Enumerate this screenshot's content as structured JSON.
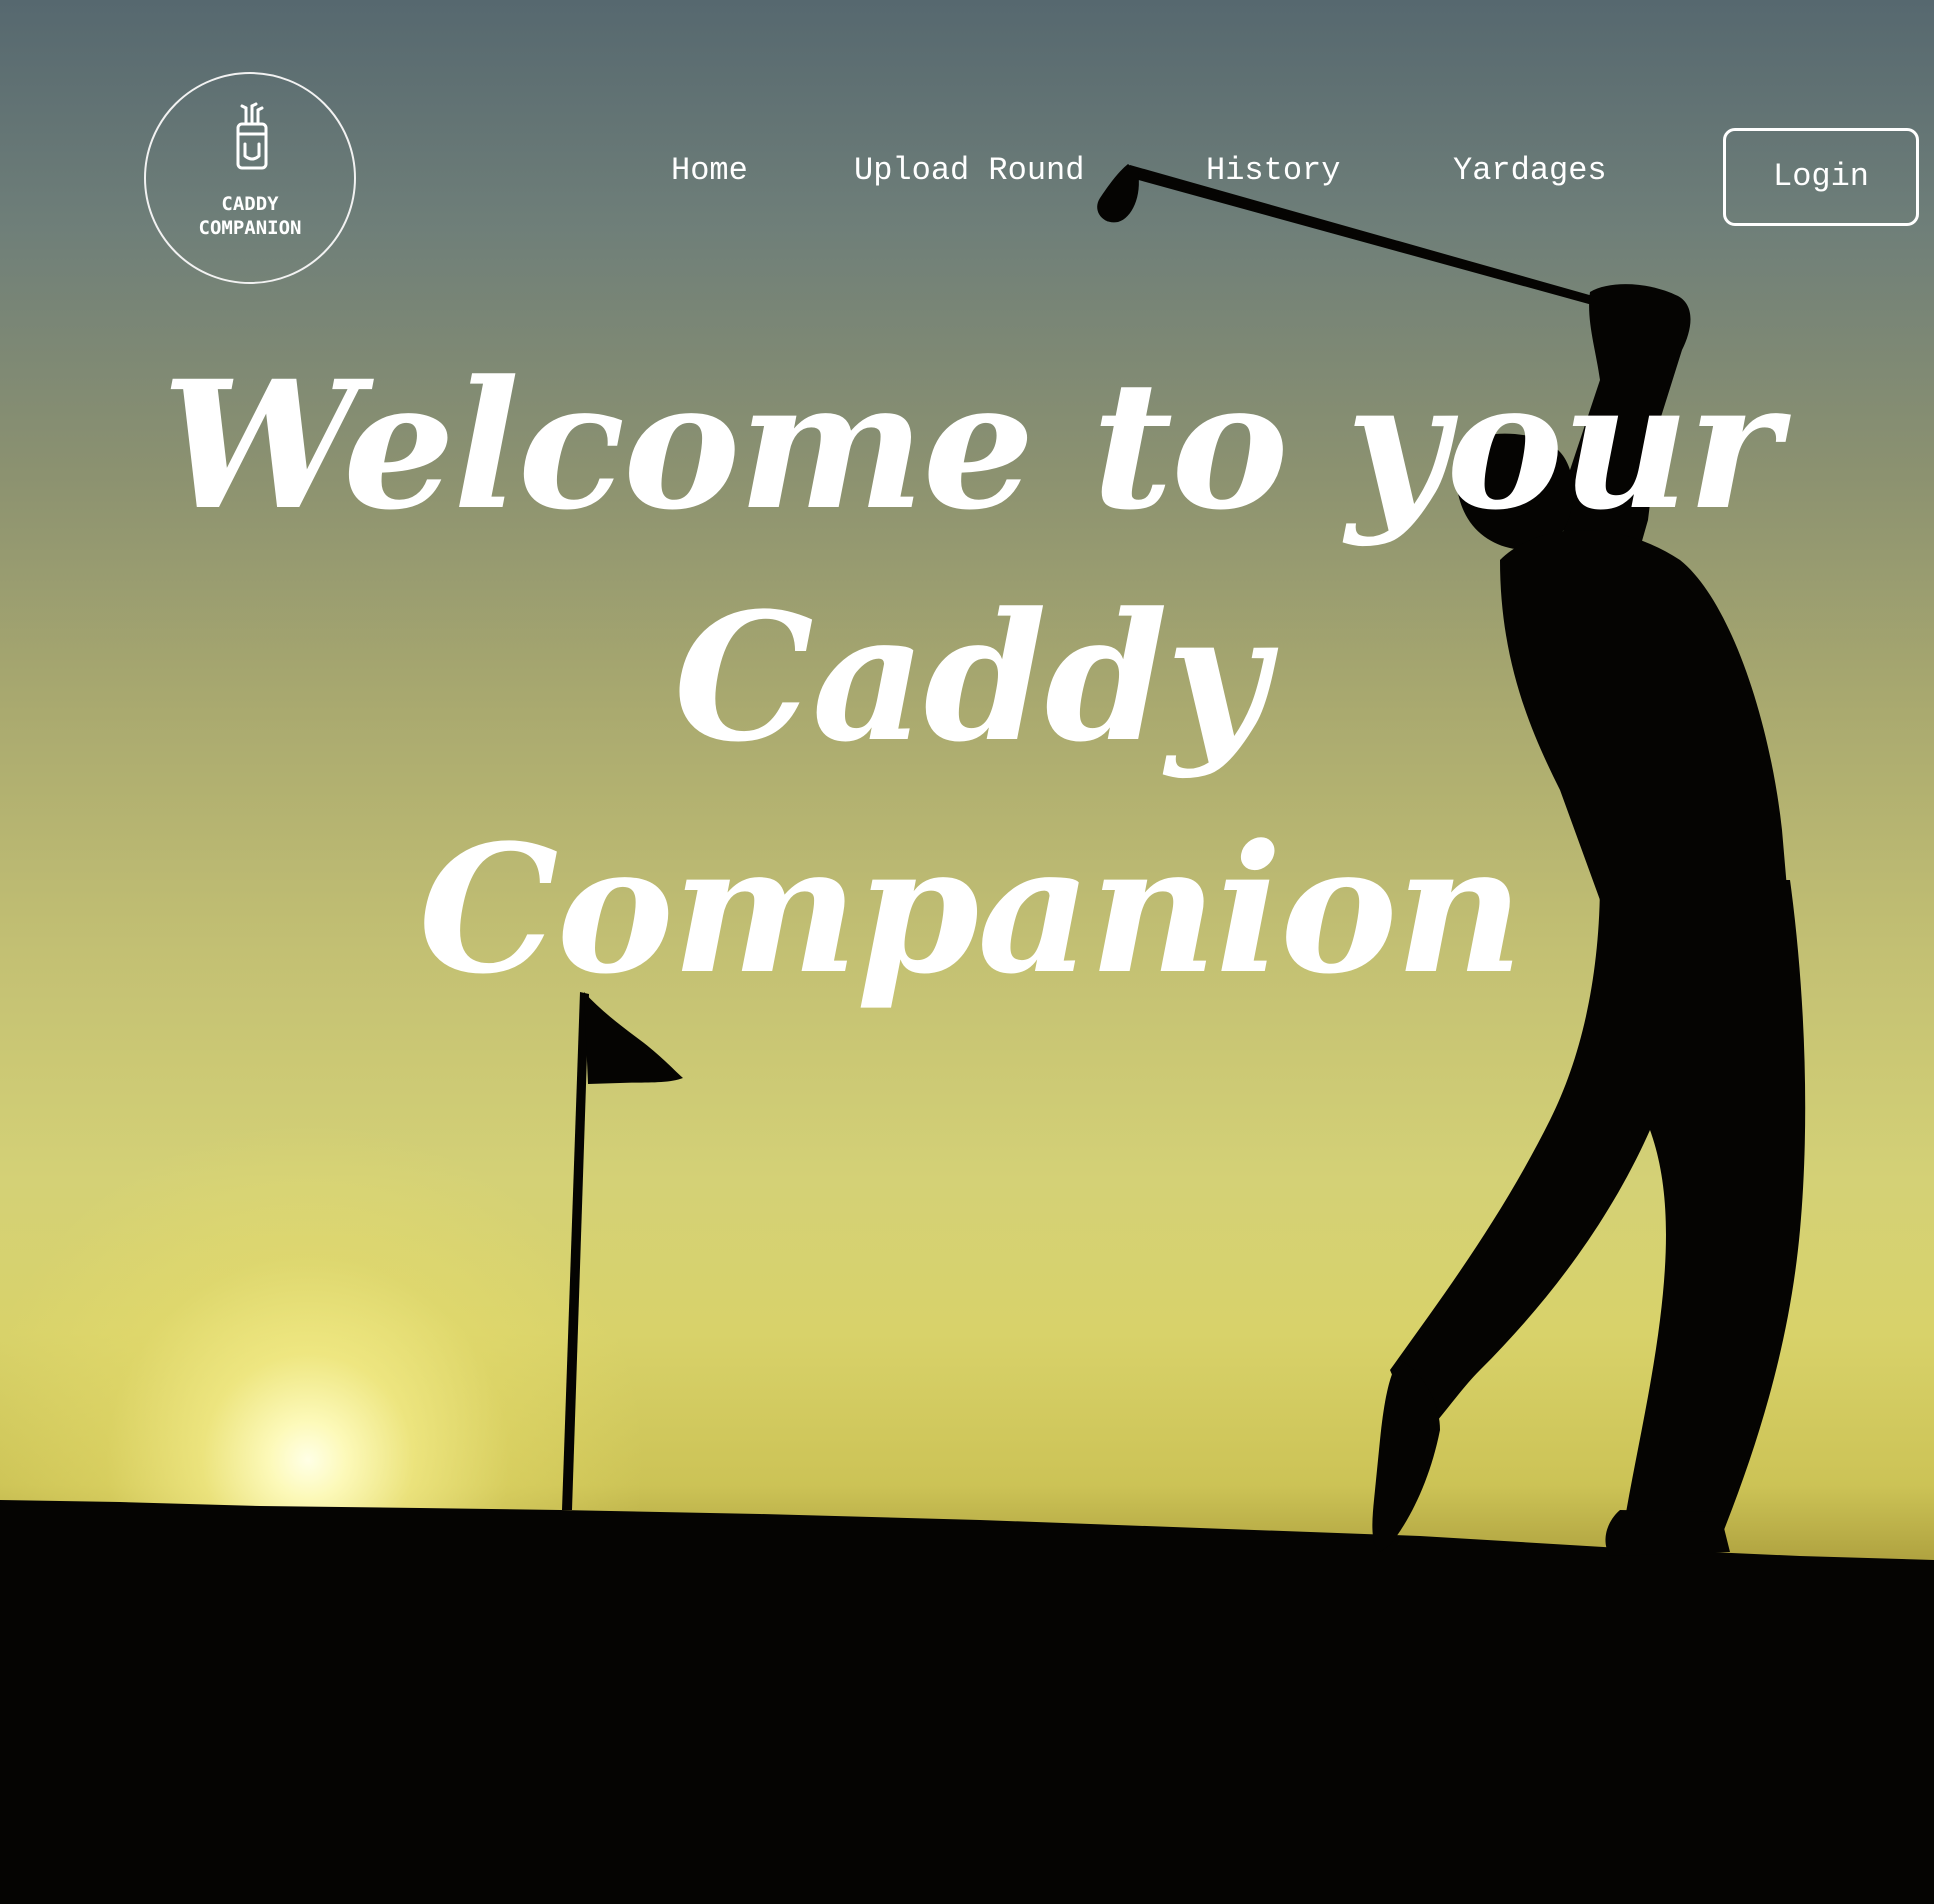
{
  "logo": {
    "icon": "golf-bag-icon",
    "line1": "CADDY",
    "line2": "COMPANION"
  },
  "nav": {
    "items": [
      {
        "label": "Home"
      },
      {
        "label": "Upload Round"
      },
      {
        "label": "History"
      },
      {
        "label": "Yardages"
      }
    ],
    "login_label": "Login"
  },
  "hero": {
    "line1": "Welcome to your Caddy",
    "line2": "Companion"
  },
  "background": {
    "description_icon": "golfer-sunset-photo",
    "sky_top_color": "#56686f",
    "sky_mid_color": "#c3c073",
    "horizon_color": "#d8d26a",
    "ground_color": "#000000"
  }
}
